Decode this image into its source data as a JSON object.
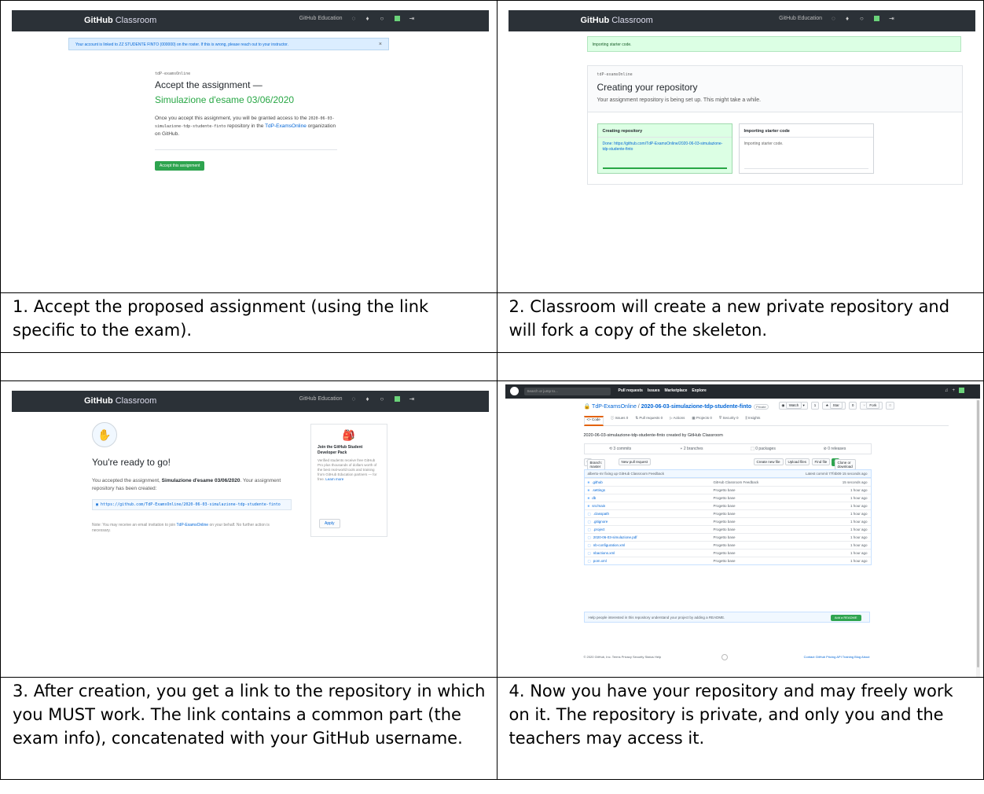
{
  "captions": {
    "c1": "1. Accept the proposed assignment (using the link specific to the exam).",
    "c2": "2. Classroom will create a new private repository and will fork a copy of the skeleton.",
    "c3": "3. After creation, you get a link to the repository in which you MUST work. The link contains a common part (the exam info), concatenated with your GitHub username.",
    "c4": "4. Now you have your repository and may freely work on it. The repository is private, and only you and the teachers may access it."
  },
  "classroom": {
    "logo_bold": "GitHub",
    "logo_light": "Classroom",
    "nav_education": "GitHub Education"
  },
  "accept": {
    "flash": "Your account is linked to ZZ STUDENTE FINTO (000000) on the roster. If this is wrong, please reach out to your instructor.",
    "org_label": "tdP-examsOnline",
    "heading": "Accept the assignment —",
    "assignment": "Simulazione d'esame 03/06/2020",
    "text_before": "Once you accept this assignment, you will be granted access to the",
    "repo_code": "2020-06-03-simulazione-tdp-studente-finto",
    "text_mid": "repository in the",
    "org_link": "TdP-ExamsOnline",
    "text_after": "organization on GitHub.",
    "button": "Accept this assignment"
  },
  "creating": {
    "flash": "Importing starter code.",
    "org_label": "tdP-examsOnline",
    "title": "Creating your repository",
    "subtitle": "Your assignment repository is being set up. This might take a while.",
    "card1_title": "Creating repository",
    "card1_body": "Done: https://github.com/TdP-ExamsOnline/2020-06-03-simulazione-tdp-studente-finto",
    "card2_title": "Importing starter code",
    "card2_body": "Importing starter code."
  },
  "ready": {
    "heading": "You're ready to go!",
    "p_before": "You accepted the assignment,",
    "p_bold": "Simulazione d'esame 03/06/2020",
    "p_after": ". Your assignment repository has been created:",
    "url": "https://github.com/TdP-ExamsOnline/2020-06-03-simulazione-tdp-studente-finto",
    "note_before": "Note: You may receive an email invitation to join",
    "note_link": "TdP-ExamsOnline",
    "note_after": "on your behalf. No further action is necessary.",
    "pack_title": "Join the GitHub Student Developer Pack",
    "pack_body": "Verified students receive free GitHub Pro plus thousands of dollars worth of the best real-world tools and training from GitHub Education partners — for free.",
    "pack_link": "Learn more",
    "apply": "Apply"
  },
  "github": {
    "search_placeholder": "Search or jump to...",
    "nav": [
      "Pull requests",
      "Issues",
      "Marketplace",
      "Explore"
    ],
    "owner": "TdP-ExamsOnline",
    "repo": "2020-06-03-simulazione-tdp-studente-finto",
    "private": "Private",
    "watch": "Watch",
    "watch_count": "1",
    "star": "Star",
    "star_count": "0",
    "fork": "Fork",
    "fork_count": "0",
    "tabs": [
      "Code",
      "Issues 0",
      "Pull requests 0",
      "Actions",
      "Projects 0",
      "Security 0",
      "Insights"
    ],
    "description": "2020-06-03-simulazione-tdp-studente-finto created by GitHub Classroom",
    "stats": [
      "3 commits",
      "2 branches",
      "0 packages",
      "0 releases"
    ],
    "branch": "Branch: master",
    "new_pr": "New pull request",
    "create_file": "Create new file",
    "upload": "Upload files",
    "find": "Find file",
    "clone": "Clone or download",
    "commit_msg": "alberto-mr fixing up GitHub Classroom Feedback",
    "commit_time": "Latest commit 77f4b09 15 seconds ago",
    "files": [
      {
        "name": ".github",
        "msg": "GitHub Classroom Feedback",
        "time": "15 seconds ago",
        "dir": true
      },
      {
        "name": ".settings",
        "msg": "Progetto base",
        "time": "1 hour ago",
        "dir": true
      },
      {
        "name": "db",
        "msg": "Progetto base",
        "time": "1 hour ago",
        "dir": true
      },
      {
        "name": "src/main",
        "msg": "Progetto base",
        "time": "1 hour ago",
        "dir": true
      },
      {
        "name": ".classpath",
        "msg": "Progetto base",
        "time": "1 hour ago",
        "dir": false
      },
      {
        "name": ".gitignore",
        "msg": "Progetto base",
        "time": "1 hour ago",
        "dir": false
      },
      {
        "name": ".project",
        "msg": "Progetto base",
        "time": "1 hour ago",
        "dir": false
      },
      {
        "name": "2020-06-03-simulazione.pdf",
        "msg": "Progetto base",
        "time": "1 hour ago",
        "dir": false
      },
      {
        "name": "nb-configuration.xml",
        "msg": "Progetto base",
        "time": "1 hour ago",
        "dir": false
      },
      {
        "name": "nbactions.xml",
        "msg": "Progetto base",
        "time": "1 hour ago",
        "dir": false
      },
      {
        "name": "pom.xml",
        "msg": "Progetto base",
        "time": "1 hour ago",
        "dir": false
      }
    ],
    "readme_msg": "Help people interested in this repository understand your project by adding a README.",
    "readme_btn": "Add a README",
    "footer_left": "© 2020 GitHub, Inc.  Terms  Privacy  Security  Status  Help",
    "footer_right": "Contact GitHub  Pricing  API  Training  Blog  About"
  }
}
